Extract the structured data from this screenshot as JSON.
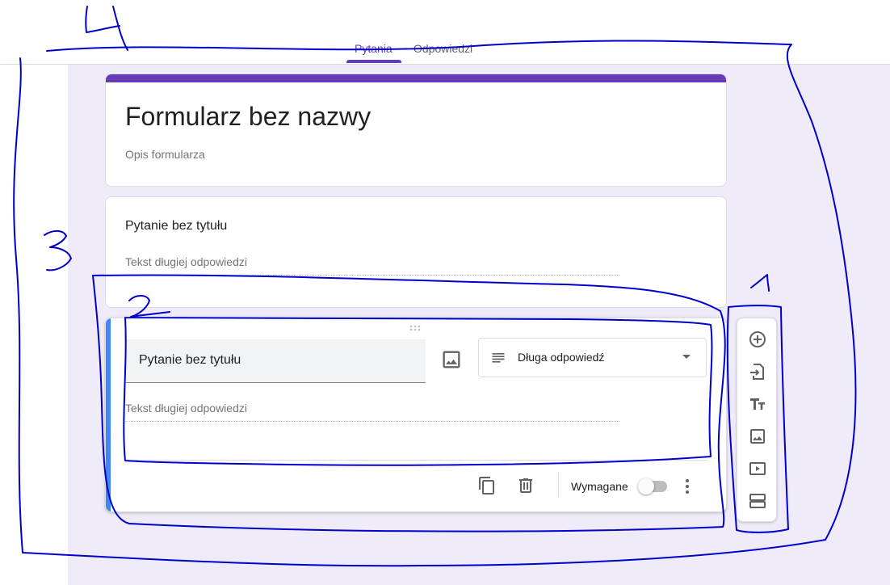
{
  "tabs": [
    {
      "label": "Pytania",
      "active": true
    },
    {
      "label": "Odpowiedzi",
      "active": false
    }
  ],
  "form": {
    "title": "Formularz bez nazwy",
    "description_placeholder": "Opis formularza"
  },
  "question_preview": {
    "title": "Pytanie bez tytułu",
    "answer_placeholder": "Tekst długiej odpowiedzi"
  },
  "question_edit": {
    "title": "Pytanie bez tytułu",
    "type_label": "Długa odpowiedź",
    "answer_placeholder": "Tekst długiej odpowiedzi",
    "required_label": "Wymagane",
    "required_on": false
  },
  "toolbar": {
    "items": [
      "add-question-icon",
      "import-questions-icon",
      "add-title-icon",
      "add-image-icon",
      "add-video-icon",
      "add-section-icon"
    ]
  },
  "annotations": {
    "labels": [
      "1",
      "2",
      "3",
      "4"
    ],
    "stroke_color": "#0000cc"
  },
  "colors": {
    "accent": "#673ab7",
    "active_card": "#4285f4",
    "canvas": "#efebf9"
  }
}
